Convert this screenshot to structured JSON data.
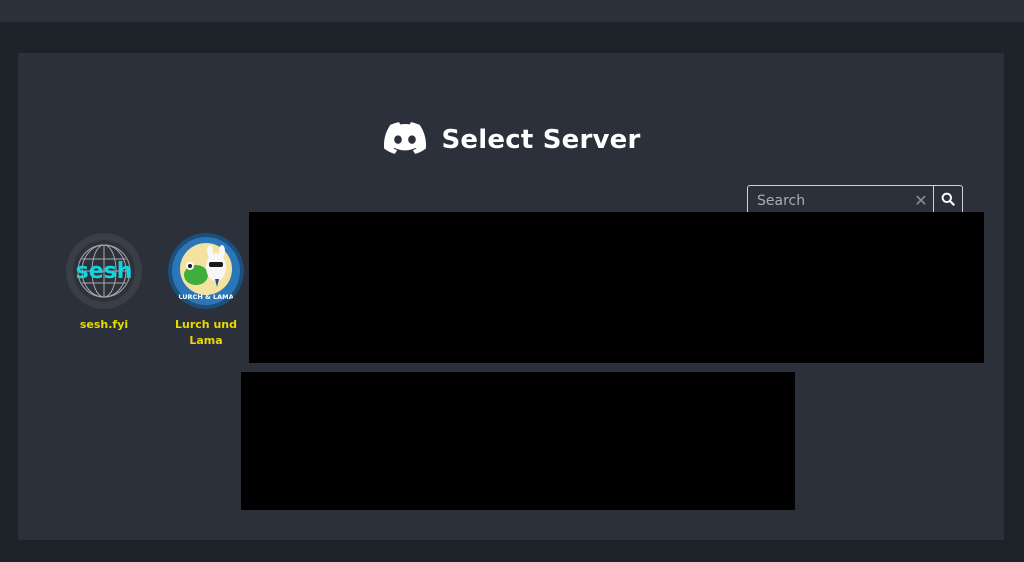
{
  "header": {
    "title": "Select Server",
    "logo_icon": "discord-logo-icon"
  },
  "search": {
    "placeholder": "Search",
    "value": "",
    "clear_icon": "close-icon",
    "search_icon": "search-icon"
  },
  "servers": [
    {
      "name": "sesh.fyi",
      "icon_text": "sesh",
      "icon": "sesh-logo-icon"
    },
    {
      "name": "Lurch und Lama",
      "icon_text": "LURCH & LAMA",
      "icon": "lurch-und-lama-logo-icon"
    }
  ],
  "colors": {
    "page_background": "#1e2229",
    "panel_background": "#2b303b",
    "server_name": "#e8d900",
    "sesh_cyan": "#14d4e0",
    "redaction": "#000000"
  }
}
